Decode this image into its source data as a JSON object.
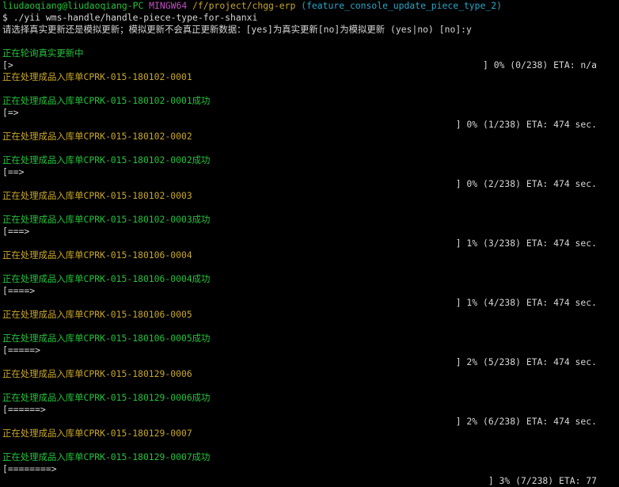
{
  "prompt": {
    "user_host": "liudaoqiang@liudaoqiang-PC",
    "system": "MINGW64",
    "path": "/f/project/chgg-erp",
    "branch": "(feature_console_update_piece_type_2)"
  },
  "command": {
    "symbol": "$",
    "text": "./yii wms-handle/handle-piece-type-for-shanxi"
  },
  "confirm_prompt": "请选择真实更新还是模拟更新；模拟更新不会真正更新数据：[yes]为真实更新[no]为模拟更新 (yes|no) [no]:y",
  "status_message": "正在轮询真实更新中",
  "progress_lines": [
    {
      "bar": "[>",
      "status": "] 0% (0/238) ETA: n/a"
    },
    {
      "bar": "[=>",
      "status": "] 0% (1/238) ETA: 474 sec."
    },
    {
      "bar": "[==>",
      "status": "] 0% (2/238) ETA: 474 sec."
    },
    {
      "bar": "[===>",
      "status": "] 1% (3/238) ETA: 474 sec."
    },
    {
      "bar": "[====>",
      "status": "] 1% (4/238) ETA: 474 sec."
    },
    {
      "bar": "[=====>",
      "status": "] 2% (5/238) ETA: 474 sec."
    },
    {
      "bar": "[======>",
      "status": "] 2% (6/238) ETA: 474 sec."
    },
    {
      "bar": "[========>",
      "status": "] 3% (7/238) ETA: 77"
    }
  ],
  "processing_lines": [
    "正在处理成品入库单CPRK-015-180102-0001",
    "正在处理成品入库单CPRK-015-180102-0002",
    "正在处理成品入库单CPRK-015-180102-0003",
    "正在处理成品入库单CPRK-015-180106-0004",
    "正在处理成品入库单CPRK-015-180106-0005",
    "正在处理成品入库单CPRK-015-180129-0006",
    "正在处理成品入库单CPRK-015-180129-0007"
  ],
  "success_lines": [
    "正在处理成品入库单CPRK-015-180102-0001成功",
    "正在处理成品入库单CPRK-015-180102-0002成功",
    "正在处理成品入库单CPRK-015-180102-0003成功",
    "正在处理成品入库单CPRK-015-180106-0004成功",
    "正在处理成品入库单CPRK-015-180106-0005成功",
    "正在处理成品入库单CPRK-015-180129-0006成功",
    "正在处理成品入库单CPRK-015-180129-0007成功"
  ],
  "colors": {
    "background": "#000000",
    "text": "#d6d6d6",
    "user_host": "#23c23c",
    "system": "#c44fc4",
    "path": "#c8a726",
    "branch": "#26a7c8",
    "processing": "#c8a726",
    "success": "#23c23c"
  }
}
